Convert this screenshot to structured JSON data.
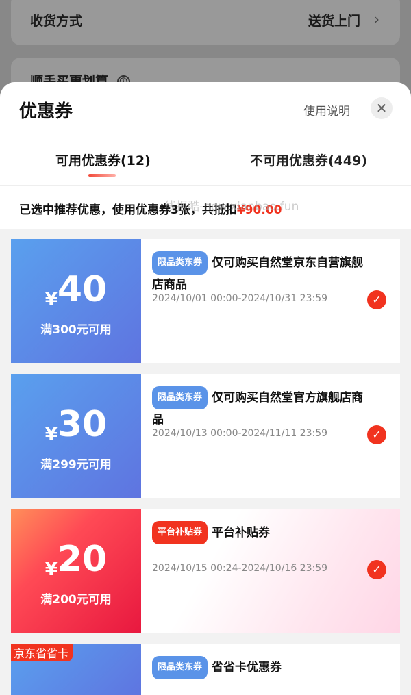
{
  "background": {
    "row1_label": "收货方式",
    "row1_value": "送货上门",
    "row2_label": "顺手买更划算",
    "row2_info_icon": "ⓘ"
  },
  "sheet": {
    "title": "优惠券",
    "help_link": "使用说明",
    "tabs": [
      {
        "label": "可用优惠券(12)",
        "active": true
      },
      {
        "label": "不可用优惠券(449)",
        "active": false
      }
    ],
    "summary_prefix": "已选中推荐优惠，使用优惠券3张，共抵扣",
    "summary_amount": "¥90.00",
    "watermark": "线报酷-new.xianbao.fun"
  },
  "coupons": [
    {
      "amount": "40",
      "currency": "¥",
      "condition": "满300元可用",
      "tag": "限品类东券",
      "name": "仅可购买自然堂京东自营旗舰店商品",
      "valid": "2024/10/01 00:00-2024/10/31 23:59",
      "selected": true,
      "style": "blue"
    },
    {
      "amount": "30",
      "currency": "¥",
      "condition": "满299元可用",
      "tag": "限品类东券",
      "name": "仅可购买自然堂官方旗舰店商品",
      "valid": "2024/10/13 00:00-2024/11/11 23:59",
      "selected": true,
      "style": "blue"
    },
    {
      "amount": "20",
      "currency": "¥",
      "condition": "满200元可用",
      "tag": "平台补贴券",
      "name": "平台补贴券",
      "valid": "2024/10/15 00:24-2024/10/16 23:59",
      "selected": true,
      "style": "red"
    },
    {
      "badge": "京东省省卡",
      "tag": "限品类东券",
      "name": "省省卡优惠券",
      "style": "blue"
    }
  ],
  "colors": {
    "accent": "#f1331f",
    "blue_tag": "#5a93e8"
  }
}
